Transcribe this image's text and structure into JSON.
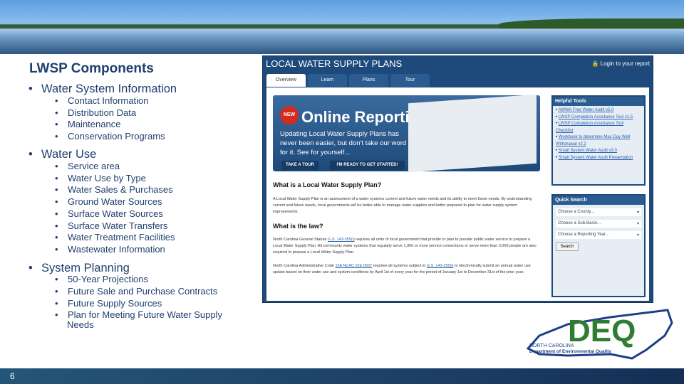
{
  "slide": {
    "title": "LWSP Components",
    "page_number": "6"
  },
  "outline": [
    {
      "label": "Water System Information",
      "items": [
        "Contact Information",
        "Distribution Data",
        "Maintenance",
        "Conservation Programs"
      ]
    },
    {
      "label": "Water Use",
      "items": [
        "Service area",
        "Water Use by Type",
        "Water Sales & Purchases",
        "Ground Water Sources",
        "Surface Water Sources",
        "Surface Water Transfers",
        "Water Treatment Facilities",
        "Wastewater Information"
      ]
    },
    {
      "label": "System Planning",
      "items": [
        "50-Year Projections",
        "Future Sale and Purchase Contracts",
        "Future Supply Sources",
        "Plan for Meeting Future Water Supply Needs"
      ]
    }
  ],
  "website": {
    "title": "LOCAL WATER SUPPLY PLANS",
    "login": "Login to your report",
    "tabs": [
      "Overview",
      "Learn",
      "Plans",
      "Tour"
    ],
    "promo": {
      "badge": "NEW",
      "heading": "Online Reporting",
      "text": "Updating Local Water Supply Plans has never been easier, but don't take our word for it. See for yourself...",
      "tour_button": "TAKE A TOUR",
      "start_button": "I'M READY TO GET STARTED!"
    },
    "h1": "What is a Local Water Supply Plan?",
    "p1": "A Local Water Supply Plan is an assessment of a water systems current and future water needs and its ability to meet those needs. By understanding current and future needs, local governments will be better able to manage water supplies and better prepared to plan for water supply system improvements.",
    "h2": "What is the law?",
    "p2a": "North Carolina General Statute ",
    "p2link": "G.S. 143-355(l)",
    "p2b": " requires all units of local government that provide or plan to provide public water service to prepare a Local Water Supply Plan. All community water systems that regularly serve 1,000 or more service connections or serve more than 3,000 people are also required to prepare a Local Water Supply Plan.",
    "p3a": "North Carolina Administrative Code ",
    "p3link": "15A NCAC 02E.0607",
    "p3b": " requires all systems subject to ",
    "p3link2": "G.S. 143-355(l)",
    "p3c": " to electronically submit an annual water use update based on their water use and system conditions by April 1st of every year for the period of January 1st to December 31st of the prior year.",
    "helpful_tools": {
      "title": "Helpful Tools",
      "links": [
        "AWWA Free Water Audit v5.0",
        "LWSP Completion Assistance Tool v1.5",
        "LWSP Completion Assistance Tool Checklist",
        "Workbook to determine Max Day Well Withdrawal v2.2",
        "Small System Water Audit v3.0",
        "Small System Water Audit Presentation"
      ]
    },
    "quick_search": {
      "title": "Quick Search",
      "selects": [
        "Choose a County...",
        "Choose a Sub-Basin...",
        "Choose a Reporting Year..."
      ],
      "button": "Search"
    }
  },
  "logo": {
    "text": "DEQ",
    "state": "NORTH CAROLINA",
    "dept": "Department of Environmental Quality"
  }
}
